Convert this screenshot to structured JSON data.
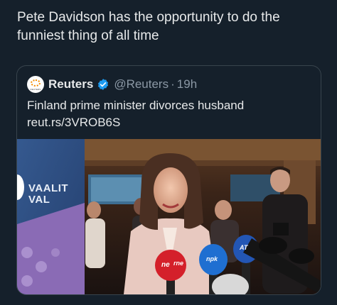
{
  "tweet": {
    "text": "Pete Davidson has the opportunity to do the funniest thing of all time"
  },
  "quoted_tweet": {
    "author_name": "Reuters",
    "handle": "@Reuters",
    "separator": "·",
    "time": "19h",
    "avatar_label": "REUTERS",
    "verified_icon": "verified-badge-icon",
    "body_line1": "Finland prime minister divorces husband",
    "body_line2": "reut.rs/3VROB6S",
    "photo": {
      "banner_text_line1": "VAALIT",
      "banner_text_line2": "VAL",
      "mic_label_1": "ne",
      "mic_label_2": "rne",
      "mic_label_3": "npk",
      "mic_label_4": "AT",
      "colors": {
        "banner": "#2e4f8a",
        "accent_purple": "#8a6bb5",
        "mic_red": "#d4202a",
        "mic_blue": "#1f6fd1",
        "jacket": "#e8c9c0"
      }
    }
  }
}
